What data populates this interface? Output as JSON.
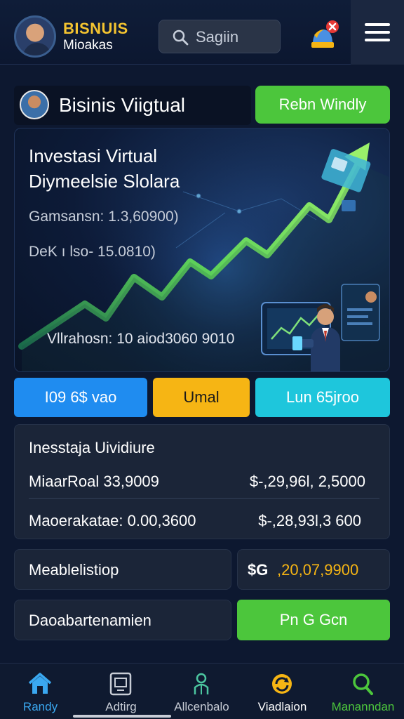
{
  "header": {
    "brand_title": "BISNUIS",
    "brand_subtitle": "Mioakas",
    "search_placeholder": "Sagiin"
  },
  "business": {
    "title": "Bisinis Viigtual",
    "top_button": "Rebn Windly"
  },
  "hero": {
    "title_line1": "Investasi Virtual",
    "title_line2": "Diymeelsie Slolara",
    "stat1": "Gamsansn: 1.3,60900)",
    "stat2": "DeK ı lso- 15.0810)",
    "stat3": "Vllrahosn: 10 aiod3060 9010"
  },
  "actions": {
    "blue": "I09 6$ vao",
    "yellow": "Umal",
    "cyan": "Lun 65jroo"
  },
  "investment": {
    "title": "Inesstaja Uividiure",
    "row1_label": "MiaarRoal 33,9009",
    "row1_value": "$-,29,96l, 2,5000",
    "row2_label": "Maoerakatae: 0.00,3600",
    "row2_value": "$-,28,93l,3 600"
  },
  "balance": {
    "label": "Meablelistiop",
    "currency": "$G",
    "value": ",20,07,9900"
  },
  "bottom": {
    "label": "Daoabartenamien",
    "button": "Pn G Gcn"
  },
  "tabs": [
    {
      "label": "Randy",
      "icon": "home-icon",
      "color": "#3aa8f0"
    },
    {
      "label": "Adtirg",
      "icon": "tablet-icon",
      "color": "#c8cdd6"
    },
    {
      "label": "Allcenbalo",
      "icon": "people-icon",
      "color": "#c8cdd6"
    },
    {
      "label": "Viadlaion",
      "icon": "refresh-coin-icon",
      "color": "#ffffff"
    },
    {
      "label": "Mananndan",
      "icon": "search-icon",
      "color": "#4cc63c"
    }
  ],
  "colors": {
    "accent_green": "#4cc63c",
    "accent_yellow": "#f6b514",
    "accent_blue": "#1f8cf0",
    "accent_cyan": "#1ec6dc",
    "background": "#0d1830"
  }
}
